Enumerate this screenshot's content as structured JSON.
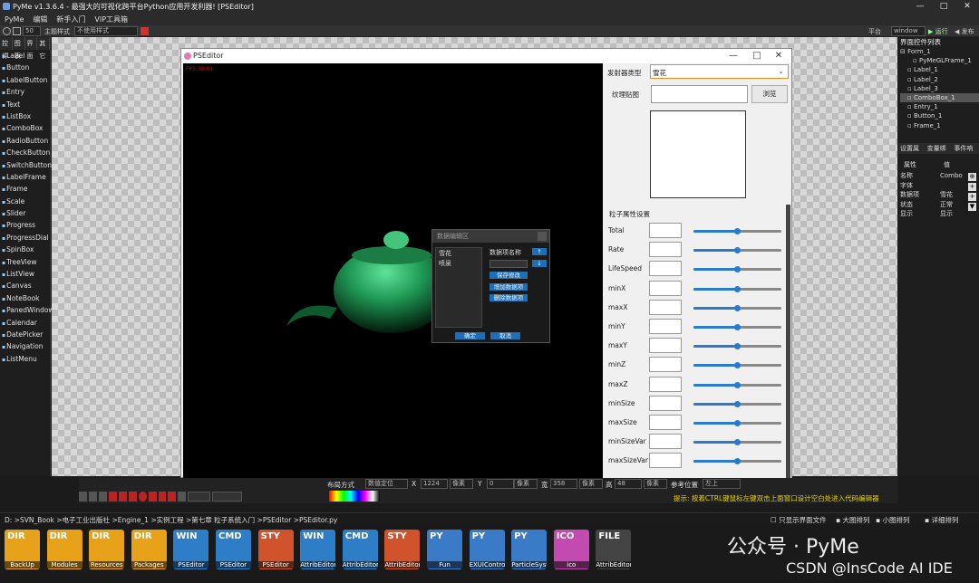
{
  "window": {
    "title": "PyMe v1.3.6.4 - 最强大的可视化跨平台Python应用开发利器! [PSEditor]"
  },
  "menu": [
    "PyMe",
    "编辑",
    "新手入门",
    "VIP工具箱"
  ],
  "toolbar": {
    "zoom": "50",
    "theme_label": "主题样式",
    "theme_value": "不使用样式",
    "platform_label": "平台",
    "platform_value": "window",
    "run": "运行",
    "publish": "发布"
  },
  "palette": {
    "tabs": [
      "控件",
      "图表",
      "界面",
      "其它"
    ],
    "items": [
      "Label",
      "Button",
      "LabelButton",
      "Entry",
      "Text",
      "ListBox",
      "ComboBox",
      "RadioButton",
      "CheckButton",
      "SwitchButton",
      "LabelFrame",
      "Frame",
      "Scale",
      "Slider",
      "Progress",
      "ProgressDial",
      "SpinBox",
      "TreeView",
      "ListView",
      "Canvas",
      "NoteBook",
      "PanedWindow",
      "Calendar",
      "DatePicker",
      "Navigation",
      "ListMenu"
    ]
  },
  "pseditor": {
    "title": "PSEditor",
    "fps": "FPS:30.01",
    "emitter_label": "发射器类型",
    "emitter_value": "雪花",
    "texture_label": "纹理贴图",
    "browse": "浏览",
    "section": "粒子属性设置",
    "params": [
      {
        "name": "Total",
        "value": 0.5
      },
      {
        "name": "Rate",
        "value": 0.5
      },
      {
        "name": "LifeSpeed",
        "value": 0.5
      },
      {
        "name": "minX",
        "value": 0.5
      },
      {
        "name": "maxX",
        "value": 0.5
      },
      {
        "name": "minY",
        "value": 0.5
      },
      {
        "name": "maxY",
        "value": 0.5
      },
      {
        "name": "minZ",
        "value": 0.5
      },
      {
        "name": "maxZ",
        "value": 0.5
      },
      {
        "name": "minSize",
        "value": 0.5
      },
      {
        "name": "maxSize",
        "value": 0.5
      },
      {
        "name": "minSizeVar",
        "value": 0.5
      },
      {
        "name": "maxSizeVar",
        "value": 0.5
      }
    ]
  },
  "dialog": {
    "title": "数据编辑区",
    "items": [
      "雪花",
      "喷泉"
    ],
    "name_label": "数据项名称",
    "save": "保存修改",
    "add": "增加数据项",
    "delete": "删除数据项",
    "ok": "确定",
    "cancel": "取消"
  },
  "tree": {
    "header": "界面控件列表",
    "nodes": [
      "Form_1",
      "PyMeGLFrame_1",
      "Label_1",
      "Label_2",
      "Label_3",
      "ComboBox_1",
      "Entry_1",
      "Button_1",
      "Frame_1"
    ]
  },
  "props": {
    "tabs": [
      "设置属",
      "变量绑",
      "事件响"
    ],
    "cols": [
      "属性",
      "值"
    ],
    "rows": [
      [
        "名称",
        "Combo"
      ],
      [
        "字体",
        ""
      ],
      [
        "数据项",
        "雪花"
      ],
      [
        "状态",
        "正常"
      ],
      [
        "显示",
        "显示"
      ]
    ]
  },
  "bottom": {
    "layout_label": "布局方式",
    "layout_value": "数值定位",
    "x_label": "X",
    "x": "1224",
    "y_label": "Y",
    "y": "0",
    "w_label": "宽",
    "w": "358",
    "h_label": "高",
    "h": "48",
    "unit": "像素",
    "ref": "参考位置",
    "ref_value": "左上",
    "hint": "提示: 按着CTRL键鼠标左键双击上面窗口设计空白处进入代码编辑器"
  },
  "path": {
    "segments": [
      "D:",
      "SVN_Book",
      "电子工业出版社",
      "Engine_1",
      "实例工程",
      "第七章 粒子系统入门",
      "PSEditor",
      "PSEditor.py"
    ],
    "only_show": "只显示界面文件",
    "big": "大图排列",
    "small": "小图排列",
    "detail": "详细排列"
  },
  "files": [
    {
      "kind": "DIR",
      "name": "BackUp",
      "color": "#e8a21a"
    },
    {
      "kind": "DIR",
      "name": "Modules",
      "color": "#e8a21a"
    },
    {
      "kind": "DIR",
      "name": "Resources",
      "color": "#e8a21a"
    },
    {
      "kind": "DIR",
      "name": "Packages",
      "color": "#e8a21a"
    },
    {
      "kind": "WIN",
      "name": "PSEditor",
      "color": "#2e7ec7"
    },
    {
      "kind": "CMD",
      "name": "PSEditor",
      "color": "#2e7ec7"
    },
    {
      "kind": "STY",
      "name": "PSEditor",
      "color": "#d0532c"
    },
    {
      "kind": "WIN",
      "name": "AttribEditor",
      "color": "#2e7ec7"
    },
    {
      "kind": "CMD",
      "name": "AttribEditor",
      "color": "#2e7ec7"
    },
    {
      "kind": "STY",
      "name": "AttribEditor",
      "color": "#d0532c"
    },
    {
      "kind": "PY",
      "name": "Fun",
      "color": "#3a7bc8"
    },
    {
      "kind": "PY",
      "name": "EXUIControl",
      "color": "#3a7bc8"
    },
    {
      "kind": "PY",
      "name": "ParticleSystem",
      "color": "#3a7bc8"
    },
    {
      "kind": "ICO",
      "name": "ico",
      "color": "#c24ab0"
    },
    {
      "kind": "FILE",
      "name": "AttribEditor",
      "color": "#444444"
    }
  ],
  "watermark": {
    "wechat": "公众号 · PyMe",
    "csdn": "CSDN @InsCode AI IDE"
  }
}
